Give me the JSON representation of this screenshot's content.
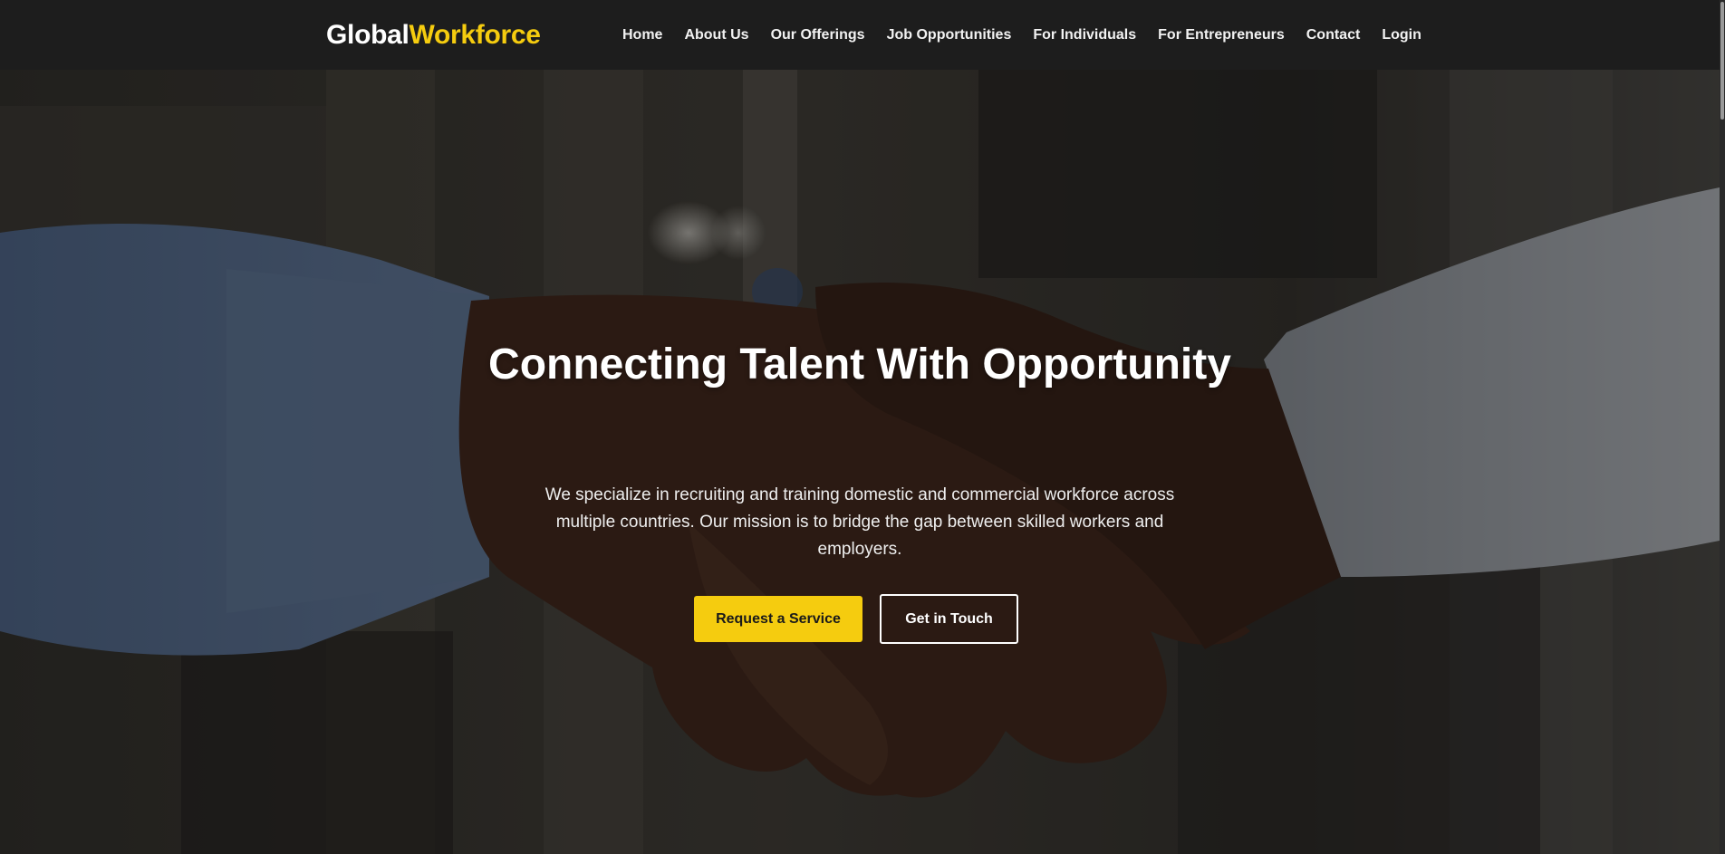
{
  "brand": {
    "part1": "Global",
    "part2": "Workforce",
    "accent_color": "#f5cc0f"
  },
  "nav": {
    "items": [
      {
        "label": "Home"
      },
      {
        "label": "About Us"
      },
      {
        "label": "Our Offerings"
      },
      {
        "label": "Job Opportunities"
      },
      {
        "label": "For Individuals"
      },
      {
        "label": "For Entrepreneurs"
      },
      {
        "label": "Contact"
      },
      {
        "label": "Login"
      }
    ]
  },
  "hero": {
    "title": "Connecting Talent With Opportunity",
    "description": "We specialize in recruiting and training domestic and commercial workforce across multiple countries. Our mission is to bridge the gap between skilled workers and employers.",
    "primary_button": "Request a Service",
    "secondary_button": "Get in Touch",
    "background_image": "handshake-photo"
  },
  "colors": {
    "navbar_bg": "#1d1d1d",
    "accent": "#f5cc0f",
    "text": "#ffffff"
  }
}
